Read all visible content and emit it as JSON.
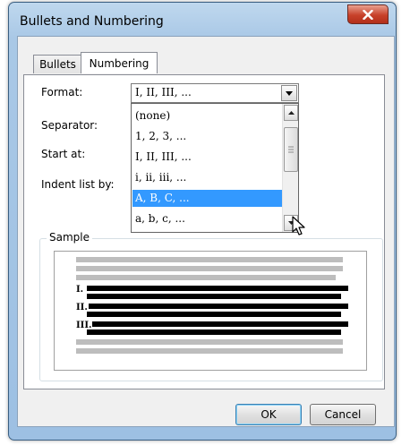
{
  "window": {
    "title": "Bullets and Numbering"
  },
  "tabs": [
    {
      "label": "Bullets",
      "active": false
    },
    {
      "label": "Numbering",
      "active": true
    }
  ],
  "fields": {
    "format_label": "Format:",
    "separator_label": "Separator:",
    "start_at_label": "Start at:",
    "indent_label": "Indent list by:"
  },
  "format": {
    "value": "I, II, III, ...",
    "options": [
      "(none)",
      "1, 2, 3, ...",
      "I, II, III, ...",
      "i, ii, iii, ...",
      "A, B, C, ...",
      "a, b, c, ..."
    ],
    "highlighted": "A, B, C, ..."
  },
  "sample": {
    "label": "Sample",
    "numbers": [
      "I.",
      "II.",
      "III."
    ]
  },
  "buttons": {
    "ok": "OK",
    "cancel": "Cancel"
  },
  "colors": {
    "selection": "#3399ff",
    "close": "#c7412a",
    "frame": "#a9c8e6"
  }
}
